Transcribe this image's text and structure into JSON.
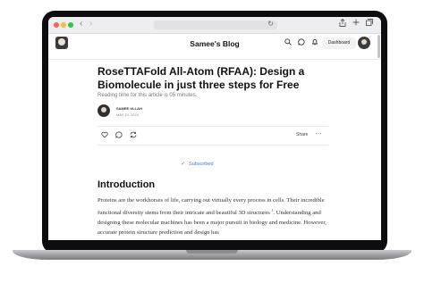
{
  "browser": {
    "back_glyph": "‹",
    "forward_glyph": "›",
    "reload_glyph": "↻",
    "share_icon": "share-icon",
    "new_tab_icon": "plus-icon",
    "tabs_icon": "tabs-icon"
  },
  "site_header": {
    "title": "Samee's Blog",
    "dashboard_label": "Dashboard",
    "icons": [
      "search-icon",
      "chat-icon",
      "bell-icon"
    ]
  },
  "article": {
    "title": "RoseTTAFold All-Atom (RFAA): Design a Biomolecule in just three steps for Free",
    "reading_time": "Reading time for this article is 05 minutes.",
    "author_name": "SAMEE ULLAH",
    "date": "MAY 23, 2024",
    "actions": {
      "share_label": "Share",
      "more_label": "···"
    },
    "subscribed_label": "Subscribed",
    "section_heading": "Introduction",
    "paragraph": "Proteins are the workhorses of life, carrying out virtually every process in cells. Their incredible functional diversity stems from their intricate and beautiful 3D structures",
    "paragraph_sup": "1",
    "paragraph_2": ". Understanding and designing these molecular machines has been a major pursuit in biology and medicine. However, accurate protein structure prediction and design has"
  },
  "colors": {
    "accent": "#3a7bd5",
    "bezel": "#0d0d0f"
  }
}
